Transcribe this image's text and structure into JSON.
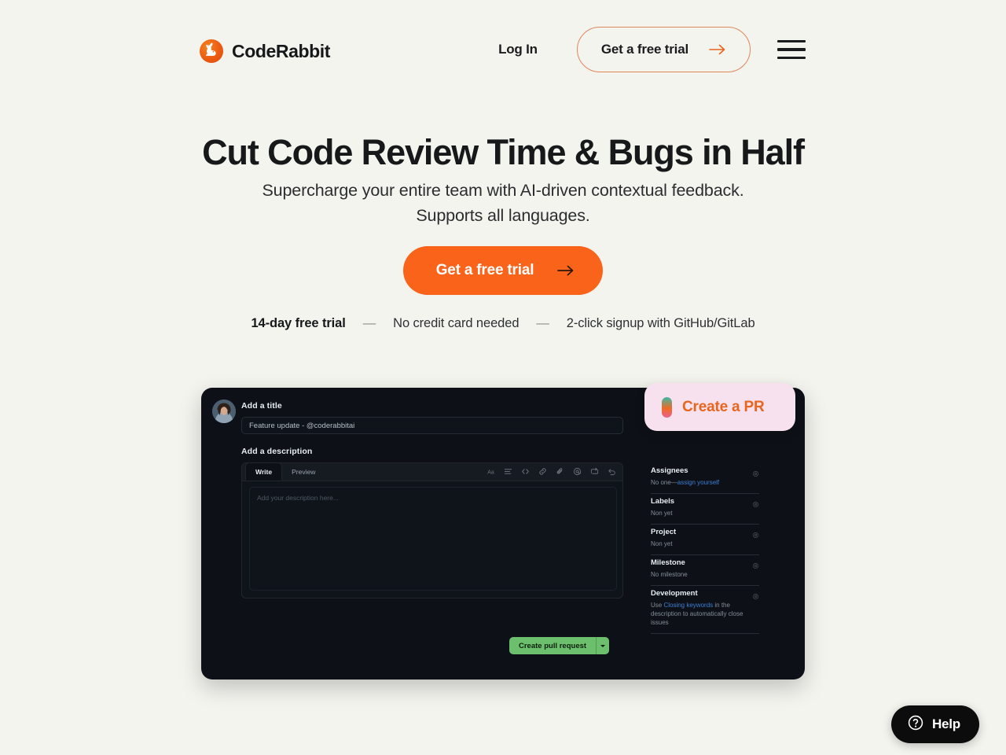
{
  "header": {
    "brand_name": "CodeRabbit",
    "brand_icon": "rabbit-logo-icon",
    "login_label": "Log In",
    "trial_button_label": "Get a free trial",
    "trial_button_arrow_icon": "arrow-right-icon",
    "menu_icon": "hamburger-menu-icon",
    "accent_color": "#f9631a",
    "outline_color": "#e2855a"
  },
  "hero": {
    "title": "Cut Code Review Time & Bugs in Half",
    "subtitle": "Supercharge your entire team with AI-driven contextual feedback. Supports all languages.",
    "cta_label": "Get a free trial",
    "cta_arrow_icon": "arrow-right-icon",
    "facts": {
      "trial_length": "14-day free trial",
      "separator": "—",
      "no_card": "No credit card needed",
      "signup": "2-click signup with GitHub/GitLab"
    }
  },
  "mockup": {
    "avatar_icon": "user-avatar",
    "title_label": "Add a title",
    "title_value": "Feature update - @coderabbitai",
    "description_label": "Add a description",
    "tabs": [
      {
        "label": "Write",
        "active": true
      },
      {
        "label": "Preview",
        "active": false
      }
    ],
    "toolbar_icons": [
      "heading-text-icon",
      "bullet-list-icon",
      "code-brackets-icon",
      "link-icon",
      "attachment-paperclip-icon",
      "mention-at-icon",
      "reply-icon",
      "undo-icon"
    ],
    "description_placeholder": "Add your description here...",
    "sidebar": [
      {
        "title": "Assignees",
        "text_before_link": "No one—",
        "link_text": "assign yourself",
        "text_after_link": "",
        "gear_icon": "gear-icon"
      },
      {
        "title": "Labels",
        "text_before_link": "Non yet",
        "link_text": "",
        "text_after_link": "",
        "gear_icon": "gear-icon"
      },
      {
        "title": "Project",
        "text_before_link": "Non yet",
        "link_text": "",
        "text_after_link": "",
        "gear_icon": "gear-icon"
      },
      {
        "title": "Milestone",
        "text_before_link": "No milestone",
        "link_text": "",
        "text_after_link": "",
        "gear_icon": "gear-icon"
      },
      {
        "title": "Development",
        "text_before_link": "Use ",
        "link_text": "Closing keywords",
        "text_after_link": " in the description to automatically close issues",
        "gear_icon": "gear-icon"
      }
    ],
    "submit_label": "Create pull request",
    "submit_caret_icon": "chevron-down-icon",
    "submit_color": "#6cbf6c"
  },
  "pr_badge": {
    "label": "Create a PR",
    "icon": "gradient-pill-icon",
    "background": "#f7e1ee",
    "text_color": "#e8651f"
  },
  "help_widget": {
    "label": "Help",
    "icon": "question-circle-icon"
  }
}
